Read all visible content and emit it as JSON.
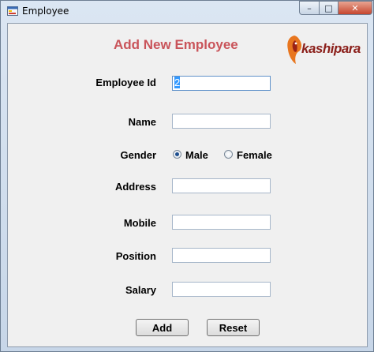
{
  "window": {
    "title": "Employee",
    "minimize": "–",
    "maximize": "□",
    "close": "✕"
  },
  "form": {
    "heading": "Add New Employee",
    "logo_text": "kashipara",
    "fields": {
      "employee_id": {
        "label": "Employee Id",
        "value": "2"
      },
      "name": {
        "label": "Name",
        "value": ""
      },
      "address": {
        "label": "Address",
        "value": ""
      },
      "mobile": {
        "label": "Mobile",
        "value": ""
      },
      "position": {
        "label": "Position",
        "value": ""
      },
      "salary": {
        "label": "Salary",
        "value": ""
      }
    },
    "gender": {
      "label": "Gender",
      "options": [
        "Male",
        "Female"
      ],
      "selected": "Male"
    },
    "buttons": {
      "add": "Add",
      "reset": "Reset"
    }
  },
  "colors": {
    "heading": "#c9554f",
    "logo": "#8b1f1a",
    "selection": "#3399ff"
  },
  "icons": {
    "app": "app-window-icon",
    "logo": "lion-logo-icon"
  }
}
